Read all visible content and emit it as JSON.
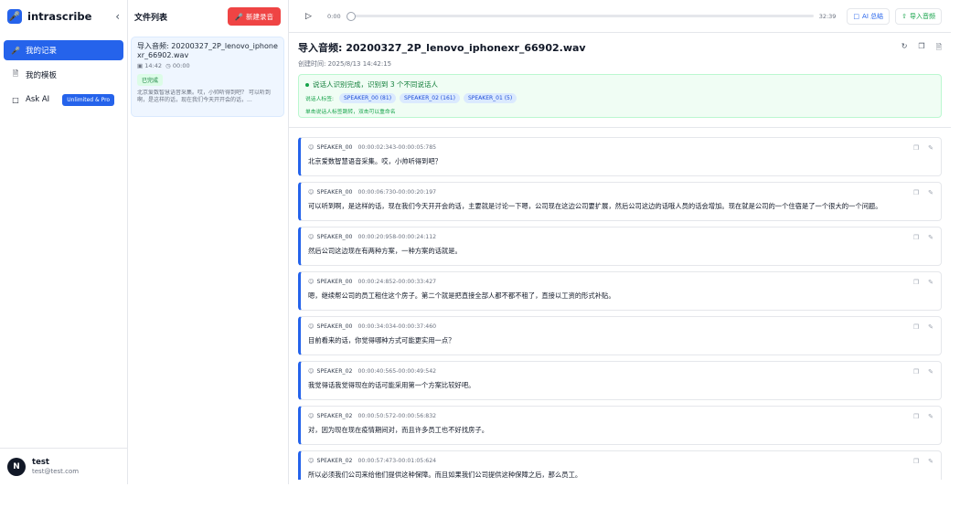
{
  "brand": {
    "name": "intrascribe",
    "logo_icon": "microphone-icon"
  },
  "sidebar": {
    "items": [
      {
        "label": "我的记录",
        "icon": "microphone-icon",
        "active": true
      },
      {
        "label": "我的模板",
        "icon": "document-icon",
        "active": false
      },
      {
        "label": "Ask AI",
        "icon": "chat-icon",
        "active": false,
        "badge": "Unlimited & Pro"
      }
    ]
  },
  "user": {
    "avatar_letter": "N",
    "name": "test",
    "email": "test@test.com"
  },
  "filelist": {
    "title": "文件列表",
    "new_button": "新建录音",
    "files": [
      {
        "title": "导入音频: 20200327_2P_lenovo_iphonexr_66902.wav",
        "time": "14:42",
        "duration": "00:00",
        "status": "已完成",
        "preview": "北京爱数智慧语音采集。哎，小帅听得到吧？ 可以听到啊，是这样的话，现在我们今天开开会的话，..."
      }
    ]
  },
  "player": {
    "current": "0:00",
    "total": "32:39",
    "progress": 0,
    "ai_summary": "AI 总结",
    "import_audio": "导入音频"
  },
  "doc": {
    "title": "导入音频: 20200327_2P_lenovo_iphonexr_66902.wav",
    "created": "创建时间: 2025/8/13 14:42:15",
    "speaker_status": "说话人识别完成，识别到 3 个不同说话人",
    "tags_label": "说话人标签:",
    "tags": [
      "SPEAKER_00 (81)",
      "SPEAKER_02 (161)",
      "SPEAKER_01 (5)"
    ],
    "tip": "单击说话人标签跳转，双击可以重命名"
  },
  "segments": [
    {
      "speaker": "SPEAKER_00",
      "range": "00:00:02:343-00:00:05:785",
      "text": "北京爱数智慧语音采集。哎，小帅听得到吧？"
    },
    {
      "speaker": "SPEAKER_00",
      "range": "00:00:06:730-00:00:20:197",
      "text": "可以听到啊，是这样的话，现在我们今天开开会的话，主要就是讨论一下嗯，公司现在这边公司要扩展，然后公司这边的话哦人员的话会增加。现在就是公司的一个住宿是了一个很大的一个问题。"
    },
    {
      "speaker": "SPEAKER_00",
      "range": "00:00:20:958-00:00:24:112",
      "text": "然后公司这边现在有两种方案，一种方案的话就是。"
    },
    {
      "speaker": "SPEAKER_00",
      "range": "00:00:24:852-00:00:33:427",
      "text": "嗯，继续帮公司的员工租住这个房子。第二个就是把直接全部人都不都不租了，直接以工资的形式补贴。"
    },
    {
      "speaker": "SPEAKER_00",
      "range": "00:00:34:034-00:00:37:460",
      "text": "目前看来的话，你觉得哪种方式可能更实用一点？"
    },
    {
      "speaker": "SPEAKER_02",
      "range": "00:00:40:565-00:00:49:542",
      "text": "我觉得话我觉得现在的话可能采用第一个方案比较好吧。"
    },
    {
      "speaker": "SPEAKER_02",
      "range": "00:00:50:572-00:00:56:832",
      "text": "对，因为现在现在疫情期间对，而且许多员工也不好找房子。"
    },
    {
      "speaker": "SPEAKER_02",
      "range": "00:00:57:473-00:01:05:624",
      "text": "所以必须我们公司来给他们提供这种保障。而且如果我们公司提供这种保障之后，那么员工。"
    }
  ]
}
